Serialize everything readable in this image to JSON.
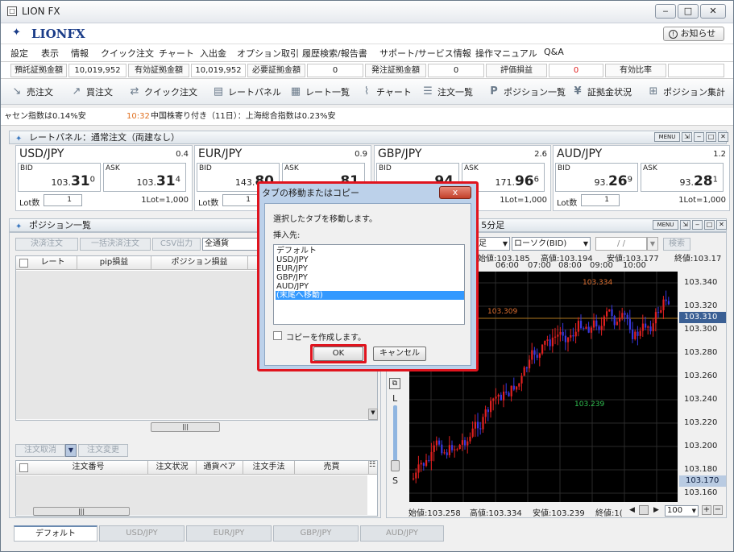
{
  "window": {
    "title": "LION FX",
    "oshirase": "お知らせ"
  },
  "brand": {
    "logo": "LIONFX"
  },
  "menu": [
    "設定",
    "表示",
    "情報",
    "クイック注文",
    "チャート",
    "入出金",
    "オプション取引",
    "履歴検索/報告書",
    "サポート/サービス情報",
    "操作マニュアル",
    "Q&A"
  ],
  "margin": {
    "deposit_label": "預託証拠金額",
    "deposit_value": "10,019,952",
    "available_label": "有効証拠金額",
    "available_value": "10,019,952",
    "required_label": "必要証拠金額",
    "required_value": "0",
    "order_label": "発注証拠金額",
    "order_value": "0",
    "pnl_label": "評価損益",
    "pnl_value": "0",
    "ratio_label": "有効比率",
    "ratio_value": ""
  },
  "toolbar": [
    "売注文",
    "買注文",
    "クイック注文",
    "レートパネル",
    "レート一覧",
    "チャート",
    "注文一覧",
    "ポジション一覧",
    "証拠金状況",
    "ポジション集計"
  ],
  "ticker": {
    "left": "ャセン指数は0.14%安",
    "time": "10:32",
    "text": "中国株寄り付き（11日）：上海総合指数は0.23%安"
  },
  "rate_panel": {
    "title": "レートパネル：通常注文（両建なし）",
    "menu": "MENU",
    "bid_label": "BID",
    "ask_label": "ASK",
    "lot_label": "Lot数",
    "lot_value": "1",
    "lot_unit": "1Lot=1,000",
    "cards": [
      {
        "pair": "USD/JPY",
        "spread": "0.4",
        "bid_main": "103.",
        "bid_big": "31",
        "bid_sup": "0",
        "ask_main": "103.",
        "ask_big": "31",
        "ask_sup": "4"
      },
      {
        "pair": "EUR/JPY",
        "spread": "0.9",
        "bid_main": "143.",
        "bid_big": "80",
        "bid_sup": "",
        "ask_main": "",
        "ask_big": "81",
        "ask_sup": ""
      },
      {
        "pair": "GBP/JPY",
        "spread": "2.6",
        "bid_main": "",
        "bid_big": "94",
        "bid_sup": "",
        "ask_main": "171.",
        "ask_big": "96",
        "ask_sup": "6"
      },
      {
        "pair": "AUD/JPY",
        "spread": "1.2",
        "bid_main": "93.",
        "bid_big": "26",
        "bid_sup": "9",
        "ask_main": "93.",
        "ask_big": "28",
        "ask_sup": "1"
      }
    ]
  },
  "positions": {
    "title": "ポジション一覧",
    "buttons": [
      "決済注文",
      "一括決済注文",
      "CSV出力"
    ],
    "filter": "全通貨",
    "columns": [
      "レート",
      "pip損益",
      "ポジション損益"
    ],
    "order_buttons": [
      "注文取消",
      "注文変更"
    ],
    "order_columns": [
      "注文番号",
      "注文状況",
      "通貨ペア",
      "注文手法",
      "売買"
    ]
  },
  "chart": {
    "title": "/ 5分足",
    "menu": "MENU",
    "type": "ローソク(BID)",
    "period": "足",
    "date": "/ /",
    "search": "検索",
    "header_start": "始値:103.185",
    "header_high": "高値:103.194",
    "header_low": "安値:103.177",
    "header_close": "終値:103.17",
    "times": [
      "06:00",
      "07:00",
      "08:00",
      "09:00",
      "10:00"
    ],
    "price_ticks": [
      "103.340",
      "103.320",
      "103.300",
      "103.280",
      "103.260",
      "103.240",
      "103.220",
      "103.200",
      "103.180",
      "103.160"
    ],
    "current_price": "103.310",
    "bid_line": "103.170",
    "high_marker": "103.334",
    "mid_marker": "103.309",
    "low_marker": "103.239",
    "footer_start": "始値:103.258",
    "footer_high": "高値:103.334",
    "footer_low": "安値:103.239",
    "footer_close": "終値:1(",
    "zoom": "100",
    "sidebar_l": "L",
    "sidebar_s": "S"
  },
  "tabs": [
    "デフォルト",
    "USD/JPY",
    "EUR/JPY",
    "GBP/JPY",
    "AUD/JPY"
  ],
  "dialog": {
    "title": "タブの移動またはコピー",
    "message": "選択したタブを移動します。",
    "insert_label": "挿入先:",
    "items": [
      "デフォルト",
      "USD/JPY",
      "EUR/JPY",
      "GBP/JPY",
      "AUD/JPY",
      "(末尾へ移動)"
    ],
    "selected": 5,
    "copy_label": "コピーを作成します。",
    "ok": "OK",
    "cancel": "キャンセル",
    "close": "x"
  },
  "colors": {
    "bull": "#e02020",
    "bear": "#3838e0",
    "highlight": "#e0141e",
    "accent": "#3399ff"
  }
}
